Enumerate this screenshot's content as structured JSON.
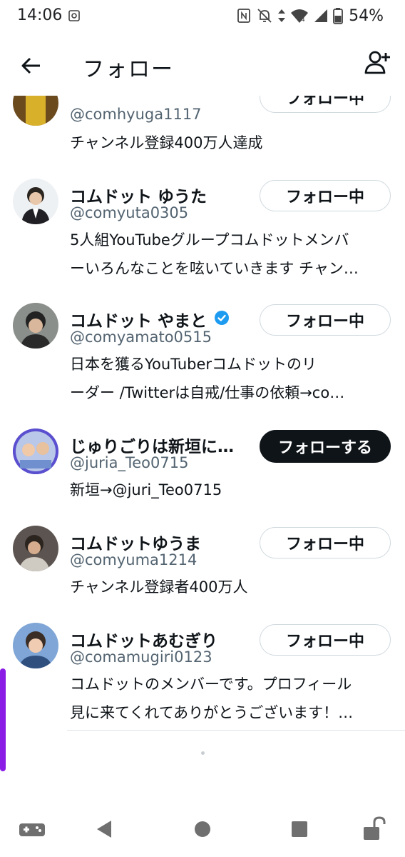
{
  "status": {
    "time": "14:06",
    "battery": "54%",
    "network": "4"
  },
  "header": {
    "title": "フォロー"
  },
  "users": [
    {
      "name": "",
      "handle": "@comhyuga1117",
      "bio": [
        "チャンネル登録400万人達成"
      ],
      "button": "フォロー中",
      "following": true,
      "verified": false
    },
    {
      "name": "コムドット ゆうた",
      "handle": "@comyuta0305",
      "bio": [
        "5人組YouTubeグループコムドットメンバ",
        "ーいろんなことを呟いていきます チャン…"
      ],
      "button": "フォロー中",
      "following": true,
      "verified": false
    },
    {
      "name": "コムドット やまと",
      "handle": "@comyamato0515",
      "bio": [
        "日本を獲るYouTuberコムドットのリ",
        "ーダー /Twitterは自戒/仕事の依頼→co…"
      ],
      "button": "フォロー中",
      "following": true,
      "verified": true
    },
    {
      "name": "じゅりごりは新垣に…",
      "handle": "@juria_Teo0715",
      "bio": [
        "新垣→@juri_Teo0715"
      ],
      "button": "フォローする",
      "following": false,
      "verified": false
    },
    {
      "name": "コムドットゆうま",
      "handle": "@comyuma1214",
      "bio": [
        "チャンネル登録者400万人"
      ],
      "button": "フォロー中",
      "following": true,
      "verified": false
    },
    {
      "name": "コムドットあむぎり",
      "handle": "@comamugiri0123",
      "bio": [
        "コムドットのメンバーです。プロフィール",
        "見に来てくれてありがとうございます！…"
      ],
      "button": "フォロー中",
      "following": true,
      "verified": false
    }
  ],
  "colors": {
    "accent_verified": "#1d9bf0",
    "primary_button": "#0f1419",
    "scroll_indicator": "#8b1ce6"
  }
}
